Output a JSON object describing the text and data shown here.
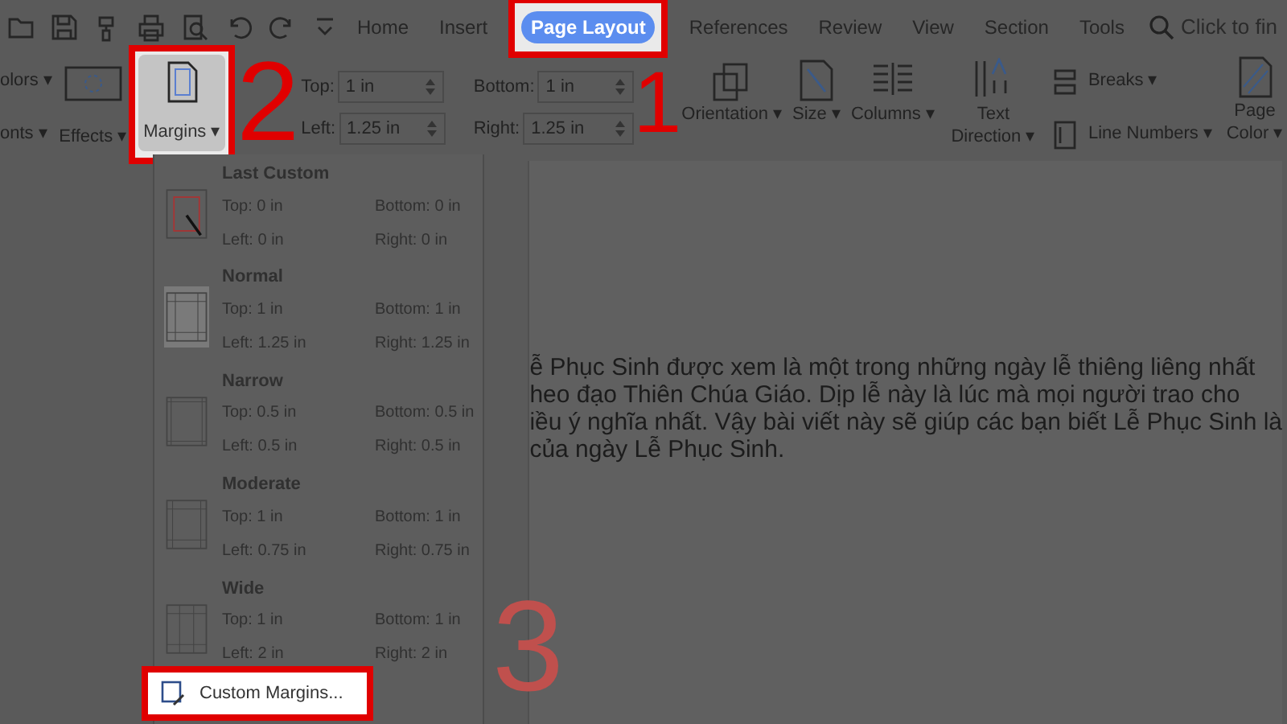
{
  "tabs": [
    {
      "label": "Home",
      "selected": false,
      "highlighted": false
    },
    {
      "label": "Insert",
      "selected": false,
      "highlighted": false
    },
    {
      "label": "Page Layout",
      "selected": true,
      "highlighted": true
    },
    {
      "label": "References",
      "selected": false,
      "highlighted": false
    },
    {
      "label": "Review",
      "selected": false,
      "highlighted": false
    },
    {
      "label": "View",
      "selected": false,
      "highlighted": false
    },
    {
      "label": "Section",
      "selected": false,
      "highlighted": false
    },
    {
      "label": "Tools",
      "selected": false,
      "highlighted": false
    }
  ],
  "search": {
    "placeholder": "Click to fin"
  },
  "ribbon": {
    "theme_items": [
      {
        "label": "olors ▾"
      },
      {
        "label": "onts ▾"
      },
      {
        "label": "Effects ▾"
      }
    ],
    "margins_button": {
      "label": "Margins ▾",
      "highlighted": true
    },
    "margin_fields": [
      {
        "label": "Top:",
        "value": "1 in"
      },
      {
        "label": "Left:",
        "value": "1.25 in"
      },
      {
        "label": "Bottom:",
        "value": "1 in"
      },
      {
        "label": "Right:",
        "value": "1.25 in"
      }
    ],
    "tools": [
      {
        "label": "Orientation ▾",
        "kind": "orientation"
      },
      {
        "label": "Size ▾",
        "kind": "size"
      },
      {
        "label": "Columns ▾",
        "kind": "columns"
      },
      {
        "label": "Text Direction ▾",
        "kind": "direction"
      }
    ],
    "small_tools": [
      {
        "label": "Breaks ▾",
        "kind": "breaks"
      },
      {
        "label": "Line Numbers ▾",
        "kind": "numbers"
      }
    ],
    "page_color": {
      "label": "Page Color ▾"
    }
  },
  "margins_menu": {
    "items": [
      {
        "name": "Last Custom",
        "kind": "custom",
        "selected": false,
        "top": "Top: 0 in",
        "bottom": "Bottom: 0 in",
        "left": "Left: 0 in",
        "right": "Right: 0 in"
      },
      {
        "name": "Normal",
        "kind": "normal",
        "selected": true,
        "top": "Top: 1 in",
        "bottom": "Bottom: 1 in",
        "left": "Left: 1.25 in",
        "right": "Right: 1.25 in"
      },
      {
        "name": "Narrow",
        "kind": "narrow",
        "selected": false,
        "top": "Top: 0.5 in",
        "bottom": "Bottom: 0.5 in",
        "left": "Left: 0.5 in",
        "right": "Right: 0.5 in"
      },
      {
        "name": "Moderate",
        "kind": "moderate",
        "selected": false,
        "top": "Top: 1 in",
        "bottom": "Bottom: 1 in",
        "left": "Left: 0.75 in",
        "right": "Right: 0.75 in"
      },
      {
        "name": "Wide",
        "kind": "wide",
        "selected": false,
        "top": "Top: 1 in",
        "bottom": "Bottom: 1 in",
        "left": "Left: 2 in",
        "right": "Right: 2 in"
      }
    ],
    "custom_margins": {
      "label": "Custom Margins...",
      "highlighted": true
    }
  },
  "document": {
    "lines": [
      "ễ Phục Sinh được xem là một trong những ngày lễ thiêng liêng nhất",
      "heo đạo Thiên Chúa Giáo. Dịp lễ này là lúc mà mọi người trao cho",
      "iều ý nghĩa nhất. Vậy bài viết này sẽ giúp các bạn biết Lễ Phục Sinh là",
      "của ngày Lễ Phục Sinh."
    ]
  },
  "annotations": [
    {
      "text": "1",
      "kind": "solid"
    },
    {
      "text": "2",
      "kind": "solid"
    },
    {
      "text": "3",
      "kind": "faded"
    }
  ]
}
